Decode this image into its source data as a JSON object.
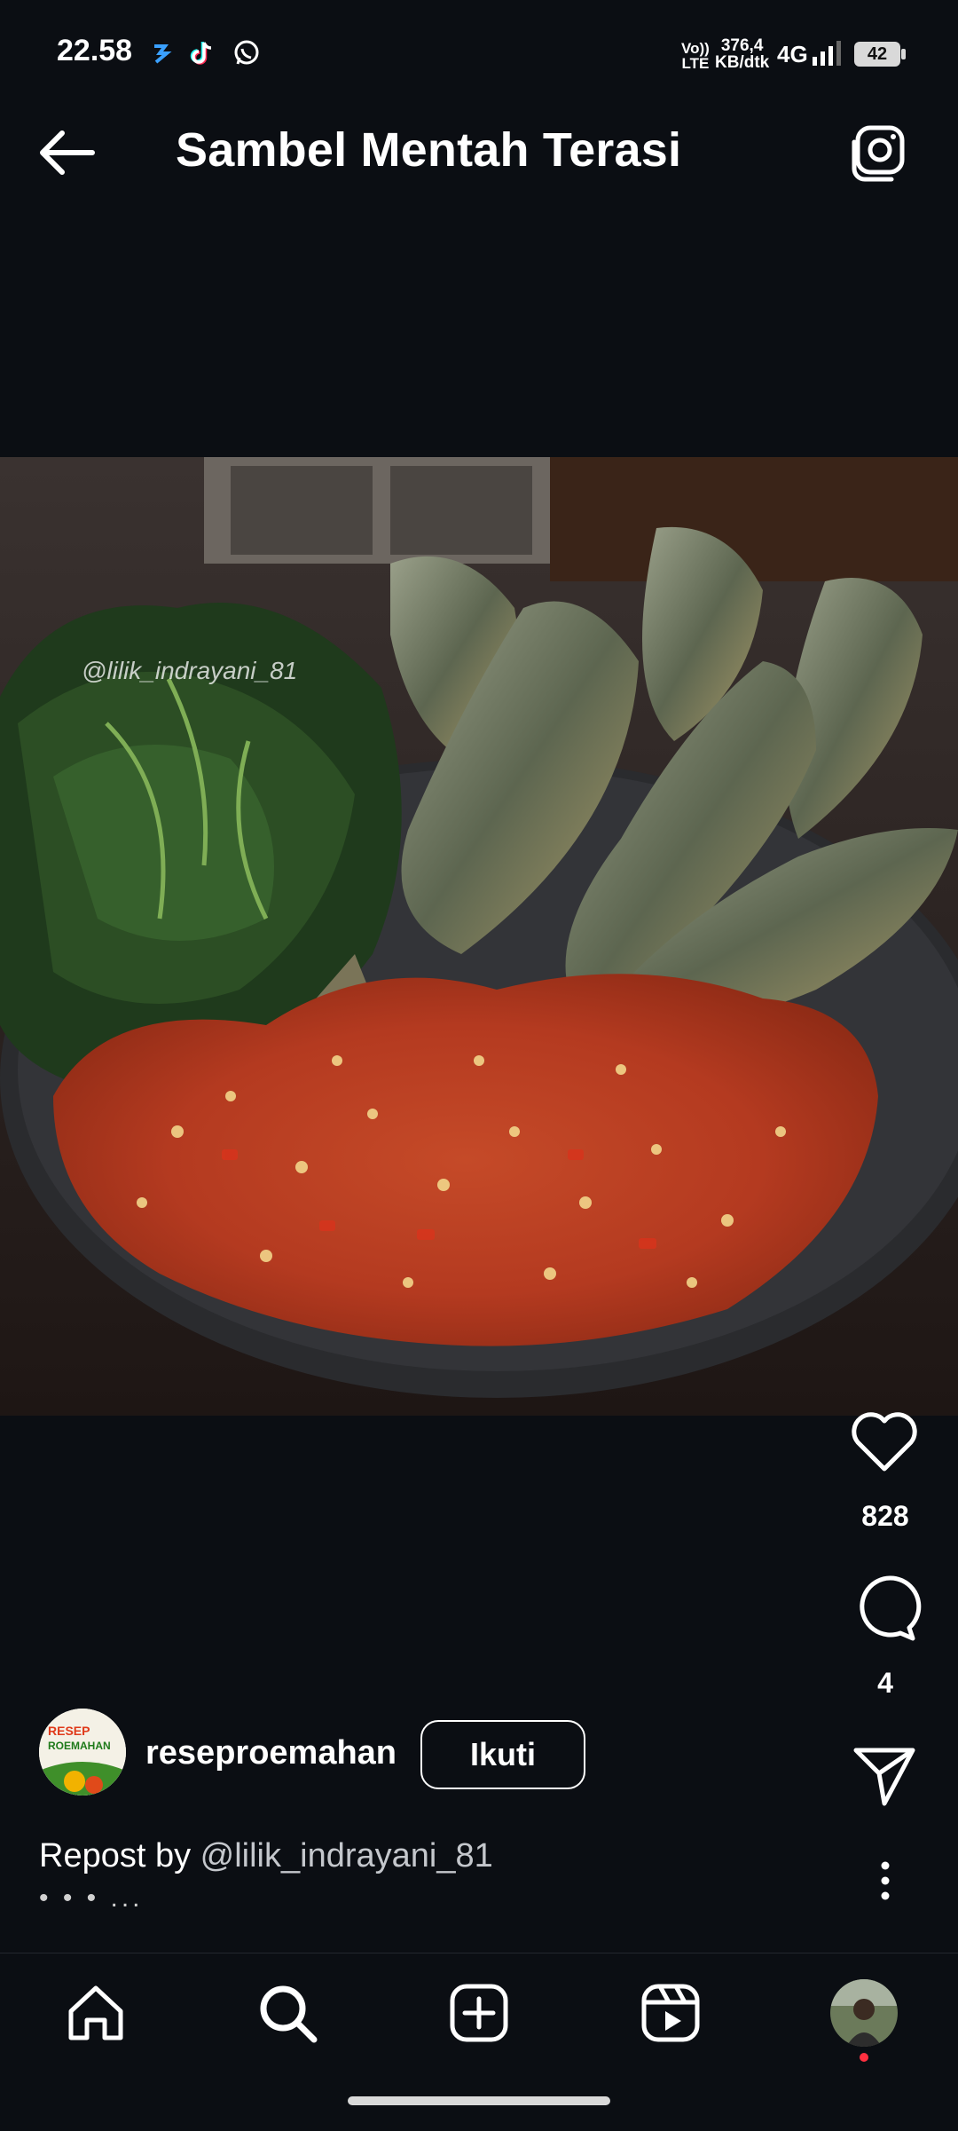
{
  "status_bar": {
    "time": "22.58",
    "network_speed_value": "376,4",
    "network_speed_unit": "KB/dtk",
    "volte_top": "Vo))",
    "volte_bottom": "LTE",
    "network_type": "4G",
    "battery": "42",
    "app_icons": [
      "notification-app-icon",
      "tiktok-icon",
      "whatsapp-icon"
    ]
  },
  "header": {
    "title": "Sambel Mentah Terasi",
    "back_icon": "arrow-left-icon",
    "camera_icon": "camera-icon"
  },
  "post": {
    "watermark": "@lilik_indrayani_81",
    "likes": "828",
    "comments": "4",
    "author": {
      "username": "reseproemahan",
      "follow_label": "Ikuti",
      "avatar_text_top": "RESEP",
      "avatar_text_bottom": "ROEMAHAN"
    },
    "caption_prefix": "Repost by",
    "caption_handle": "@lilik_indrayani_81",
    "caption_more": "• • • ..."
  },
  "bottom_nav": {
    "items": [
      "home-icon",
      "search-icon",
      "create-icon",
      "reels-icon",
      "profile-avatar"
    ]
  },
  "colors": {
    "background": "#0b0e13",
    "notification_dot": "#ff3040",
    "text": "#ffffff"
  }
}
